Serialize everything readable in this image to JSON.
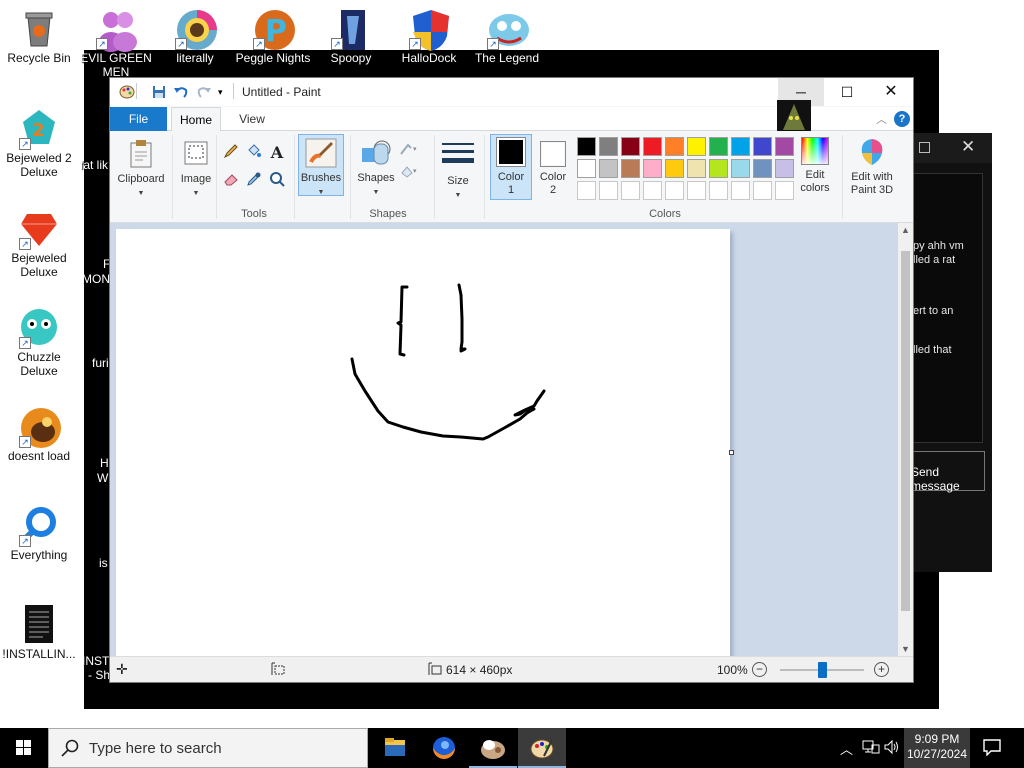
{
  "desktop": {
    "icons": [
      {
        "id": "recycle-bin",
        "label": "Recycle Bin"
      },
      {
        "id": "evil-green",
        "label": "EVIL GREEN MEN"
      },
      {
        "id": "literally",
        "label": "literally"
      },
      {
        "id": "peggle-nights",
        "label": "Peggle Nights"
      },
      {
        "id": "spoopy",
        "label": "Spoopy"
      },
      {
        "id": "hallodock",
        "label": "HalloDock"
      },
      {
        "id": "the-legend",
        "label": "The Legend"
      },
      {
        "id": "bejeweled-2",
        "label": "Bejeweled 2 Deluxe"
      },
      {
        "id": "bejeweled",
        "label": "Bejeweled Deluxe"
      },
      {
        "id": "chuzzle",
        "label": "Chuzzle Deluxe"
      },
      {
        "id": "doesnt-load",
        "label": "doesnt load"
      },
      {
        "id": "everything",
        "label": "Everything"
      },
      {
        "id": "installing",
        "label": "!INSTALLIN..."
      }
    ],
    "partial_labels": {
      "fat": "fat lik",
      "mon_a": "F",
      "mon_b": "MON",
      "fur": "furi",
      "hw_a": "H",
      "hw_b": "W",
      "is": "is",
      "inst_a": "INST",
      "inst_b": "- Sh"
    },
    "bg_window": {
      "lines": [
        "py ahh vm",
        "lled a rat",
        "ert to an",
        "lled that"
      ],
      "send_label": "Send message"
    }
  },
  "paint": {
    "title": "Untitled - Paint",
    "tabs": {
      "file": "File",
      "home": "Home",
      "view": "View"
    },
    "ribbon": {
      "clipboard": "Clipboard",
      "image": "Image",
      "tools": "Tools",
      "brushes": "Brushes",
      "shapes_btn": "Shapes",
      "shapes_group": "Shapes",
      "size": "Size",
      "color1": "Color",
      "color1_num": "1",
      "color2": "Color",
      "color2_num": "2",
      "colors_group": "Colors",
      "edit_colors_a": "Edit",
      "edit_colors_b": "colors",
      "paint3d_a": "Edit with",
      "paint3d_b": "Paint 3D"
    },
    "palette": [
      "#000000",
      "#7f7f7f",
      "#880015",
      "#ed1c24",
      "#ff7f27",
      "#fff200",
      "#22b14c",
      "#00a2e8",
      "#3f48cc",
      "#a349a4",
      "#ffffff",
      "#c3c3c3",
      "#b97a57",
      "#ffaec9",
      "#ffc90e",
      "#efe4b0",
      "#b5e61d",
      "#99d9ea",
      "#7092be",
      "#c8bfe7"
    ],
    "color1_value": "#000000",
    "color2_value": "#ffffff",
    "status": {
      "size": "614 × 460px",
      "zoom": "100%"
    }
  },
  "taskbar": {
    "search_placeholder": "Type here to search",
    "time": "9:09 PM",
    "date": "10/27/2024"
  }
}
